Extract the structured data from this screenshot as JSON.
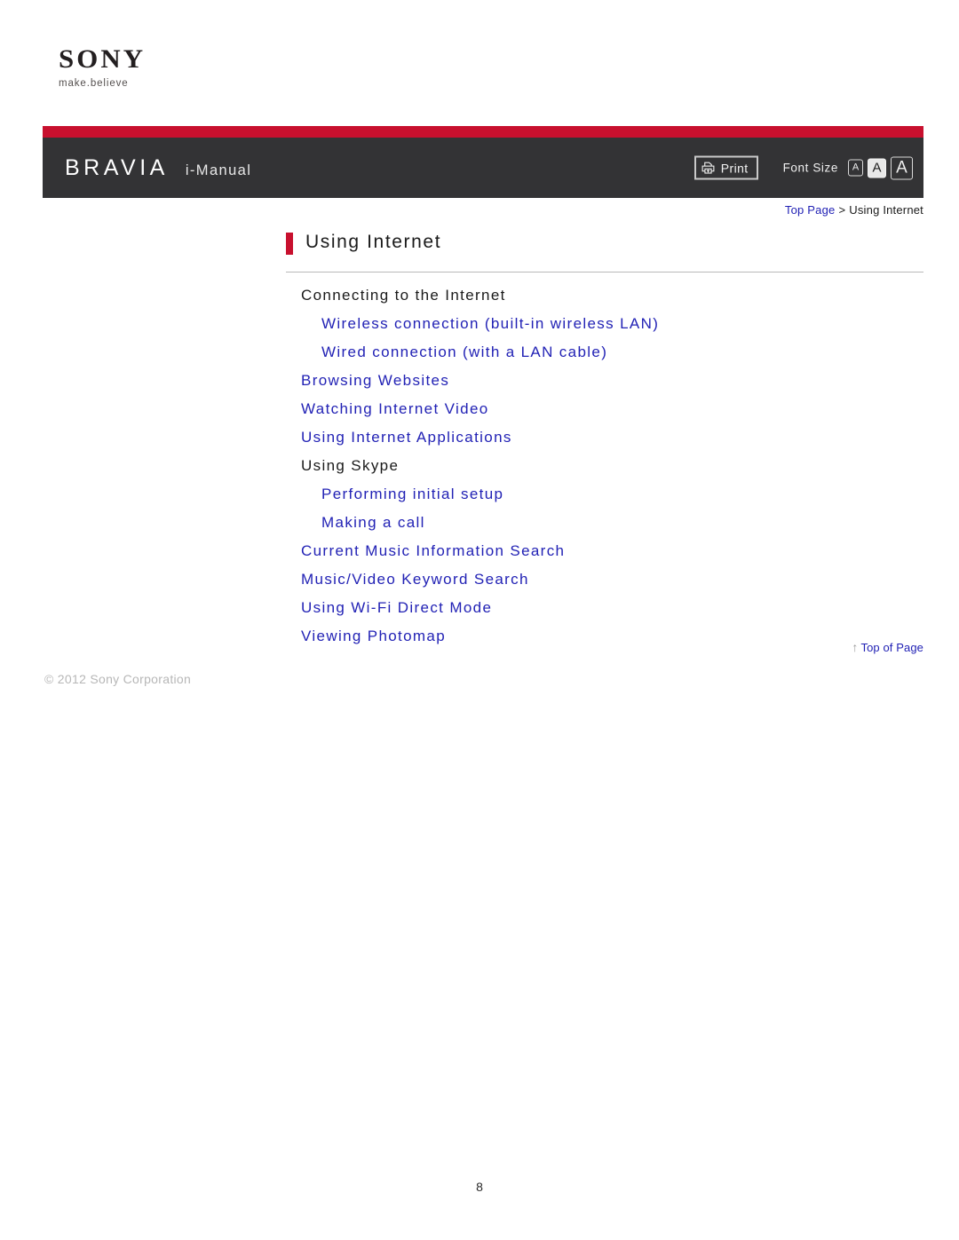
{
  "brand": {
    "logo_wordmark": "SONY",
    "logo_tagline": "make.believe",
    "product_name": "BRAVIA",
    "manual_name": "i-Manual"
  },
  "toolbar": {
    "print_label": "Print",
    "print_icon": "printer-icon",
    "font_size_label": "Font Size",
    "font_size_options": [
      {
        "label": "A",
        "size": "small",
        "selected": false
      },
      {
        "label": "A",
        "size": "medium",
        "selected": true
      },
      {
        "label": "A",
        "size": "large",
        "selected": false
      }
    ]
  },
  "breadcrumb": {
    "home_label": "Top Page",
    "separator": ">",
    "current_label": "Using Internet"
  },
  "page": {
    "title": "Using Internet",
    "accent_color": "#c8102e",
    "link_color": "#2222b5",
    "header_bar_color": "#333335",
    "number": "8"
  },
  "toc": {
    "items": [
      {
        "label": "Connecting to the Internet",
        "level": 0,
        "is_link": false
      },
      {
        "label": "Wireless connection (built-in wireless LAN)",
        "level": 1,
        "is_link": true
      },
      {
        "label": "Wired connection (with a LAN cable)",
        "level": 1,
        "is_link": true
      },
      {
        "label": "Browsing Websites",
        "level": 0,
        "is_link": true
      },
      {
        "label": "Watching Internet Video",
        "level": 0,
        "is_link": true
      },
      {
        "label": "Using Internet Applications",
        "level": 0,
        "is_link": true
      },
      {
        "label": "Using Skype",
        "level": 0,
        "is_link": false
      },
      {
        "label": "Performing initial setup",
        "level": 1,
        "is_link": true
      },
      {
        "label": "Making a call",
        "level": 1,
        "is_link": true
      },
      {
        "label": "Current Music Information Search",
        "level": 0,
        "is_link": true
      },
      {
        "label": "Music/Video Keyword Search",
        "level": 0,
        "is_link": true
      },
      {
        "label": "Using Wi-Fi Direct Mode",
        "level": 0,
        "is_link": true
      },
      {
        "label": "Viewing Photomap",
        "level": 0,
        "is_link": true
      }
    ]
  },
  "footer": {
    "top_of_page_label": "Top of Page",
    "top_of_page_arrow": "↑",
    "copyright": "© 2012 Sony Corporation"
  }
}
